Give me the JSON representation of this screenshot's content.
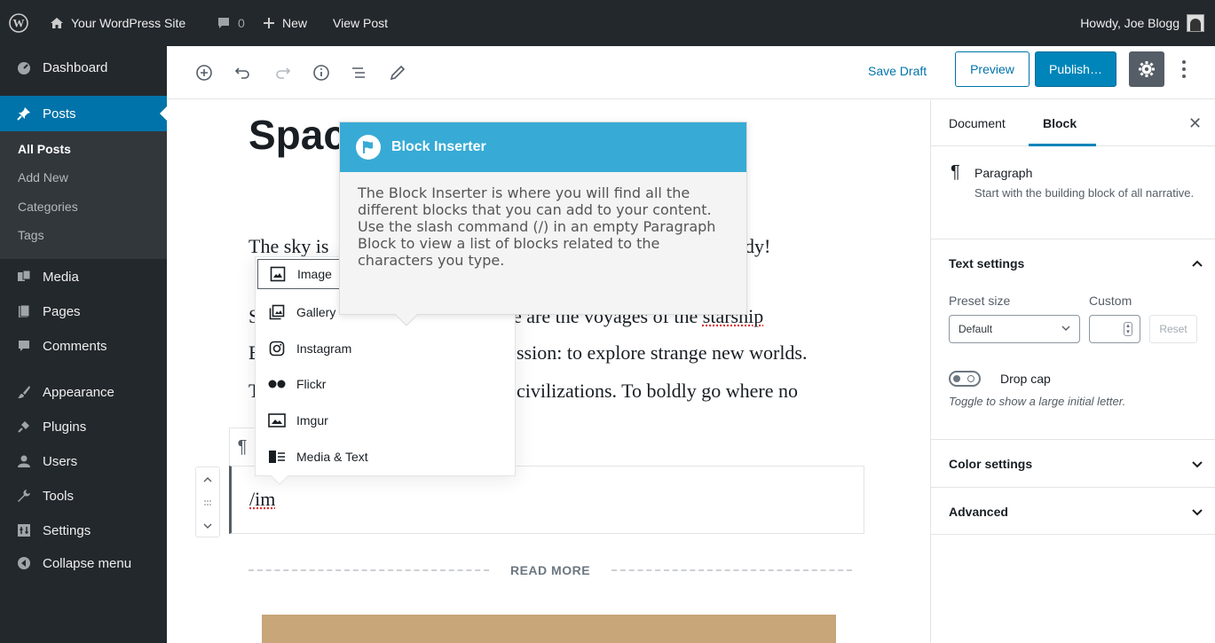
{
  "adminbar": {
    "site_name": "Your WordPress Site",
    "comments_count": "0",
    "new_label": "New",
    "view_post_label": "View Post",
    "howdy": "Howdy, Joe Blogg"
  },
  "sidebar": {
    "items": [
      {
        "label": "Dashboard",
        "icon": "dashboard-icon"
      },
      {
        "label": "Posts",
        "icon": "pushpin-icon"
      },
      {
        "label": "Media",
        "icon": "media-icon"
      },
      {
        "label": "Pages",
        "icon": "pages-icon"
      },
      {
        "label": "Comments",
        "icon": "comment-icon"
      },
      {
        "label": "Appearance",
        "icon": "brush-icon"
      },
      {
        "label": "Plugins",
        "icon": "plugin-icon"
      },
      {
        "label": "Users",
        "icon": "users-icon"
      },
      {
        "label": "Tools",
        "icon": "wrench-icon"
      },
      {
        "label": "Settings",
        "icon": "settings-icon"
      },
      {
        "label": "Collapse menu",
        "icon": "collapse-icon"
      }
    ],
    "submenu": [
      "All Posts",
      "Add New",
      "Categories",
      "Tags"
    ]
  },
  "toolbar": {
    "save_draft": "Save Draft",
    "preview": "Preview",
    "publish": "Publish…"
  },
  "post": {
    "title": "Spac",
    "lines": [
      "The sky is",
      "dy!",
      "S",
      "e are the voyages of the",
      "starship",
      "E",
      "ssion: to explore strange new worlds.",
      "T",
      "civilizations. To boldly go where no"
    ],
    "slash_command": "/im",
    "read_more": "READ MORE"
  },
  "autocomplete": {
    "items": [
      {
        "label": "Image",
        "icon": "image-icon"
      },
      {
        "label": "Gallery",
        "icon": "gallery-icon"
      },
      {
        "label": "Instagram",
        "icon": "instagram-icon"
      },
      {
        "label": "Flickr",
        "icon": "flickr-icon"
      },
      {
        "label": "Imgur",
        "icon": "imgur-icon"
      },
      {
        "label": "Media & Text",
        "icon": "media-text-icon"
      }
    ]
  },
  "tip": {
    "title": "Block Inserter",
    "body": "The Block Inserter is where you will find all the different blocks that you can add to your content. Use the slash command (/) in an empty Paragraph Block to view a list of blocks related to the characters you type."
  },
  "settings": {
    "tab_document": "Document",
    "tab_block": "Block",
    "block_title": "Paragraph",
    "block_desc": "Start with the building block of all narrative.",
    "text_settings": "Text settings",
    "preset_size": "Preset size",
    "custom": "Custom",
    "preset_value": "Default",
    "reset": "Reset",
    "drop_cap": "Drop cap",
    "drop_cap_help": "Toggle to show a large initial letter.",
    "color_settings": "Color settings",
    "advanced": "Advanced"
  },
  "colors": {
    "admin_dark": "#23282d",
    "accent_blue": "#0073aa",
    "tip_header": "#37abd5",
    "publish_blue": "#0085ba"
  }
}
